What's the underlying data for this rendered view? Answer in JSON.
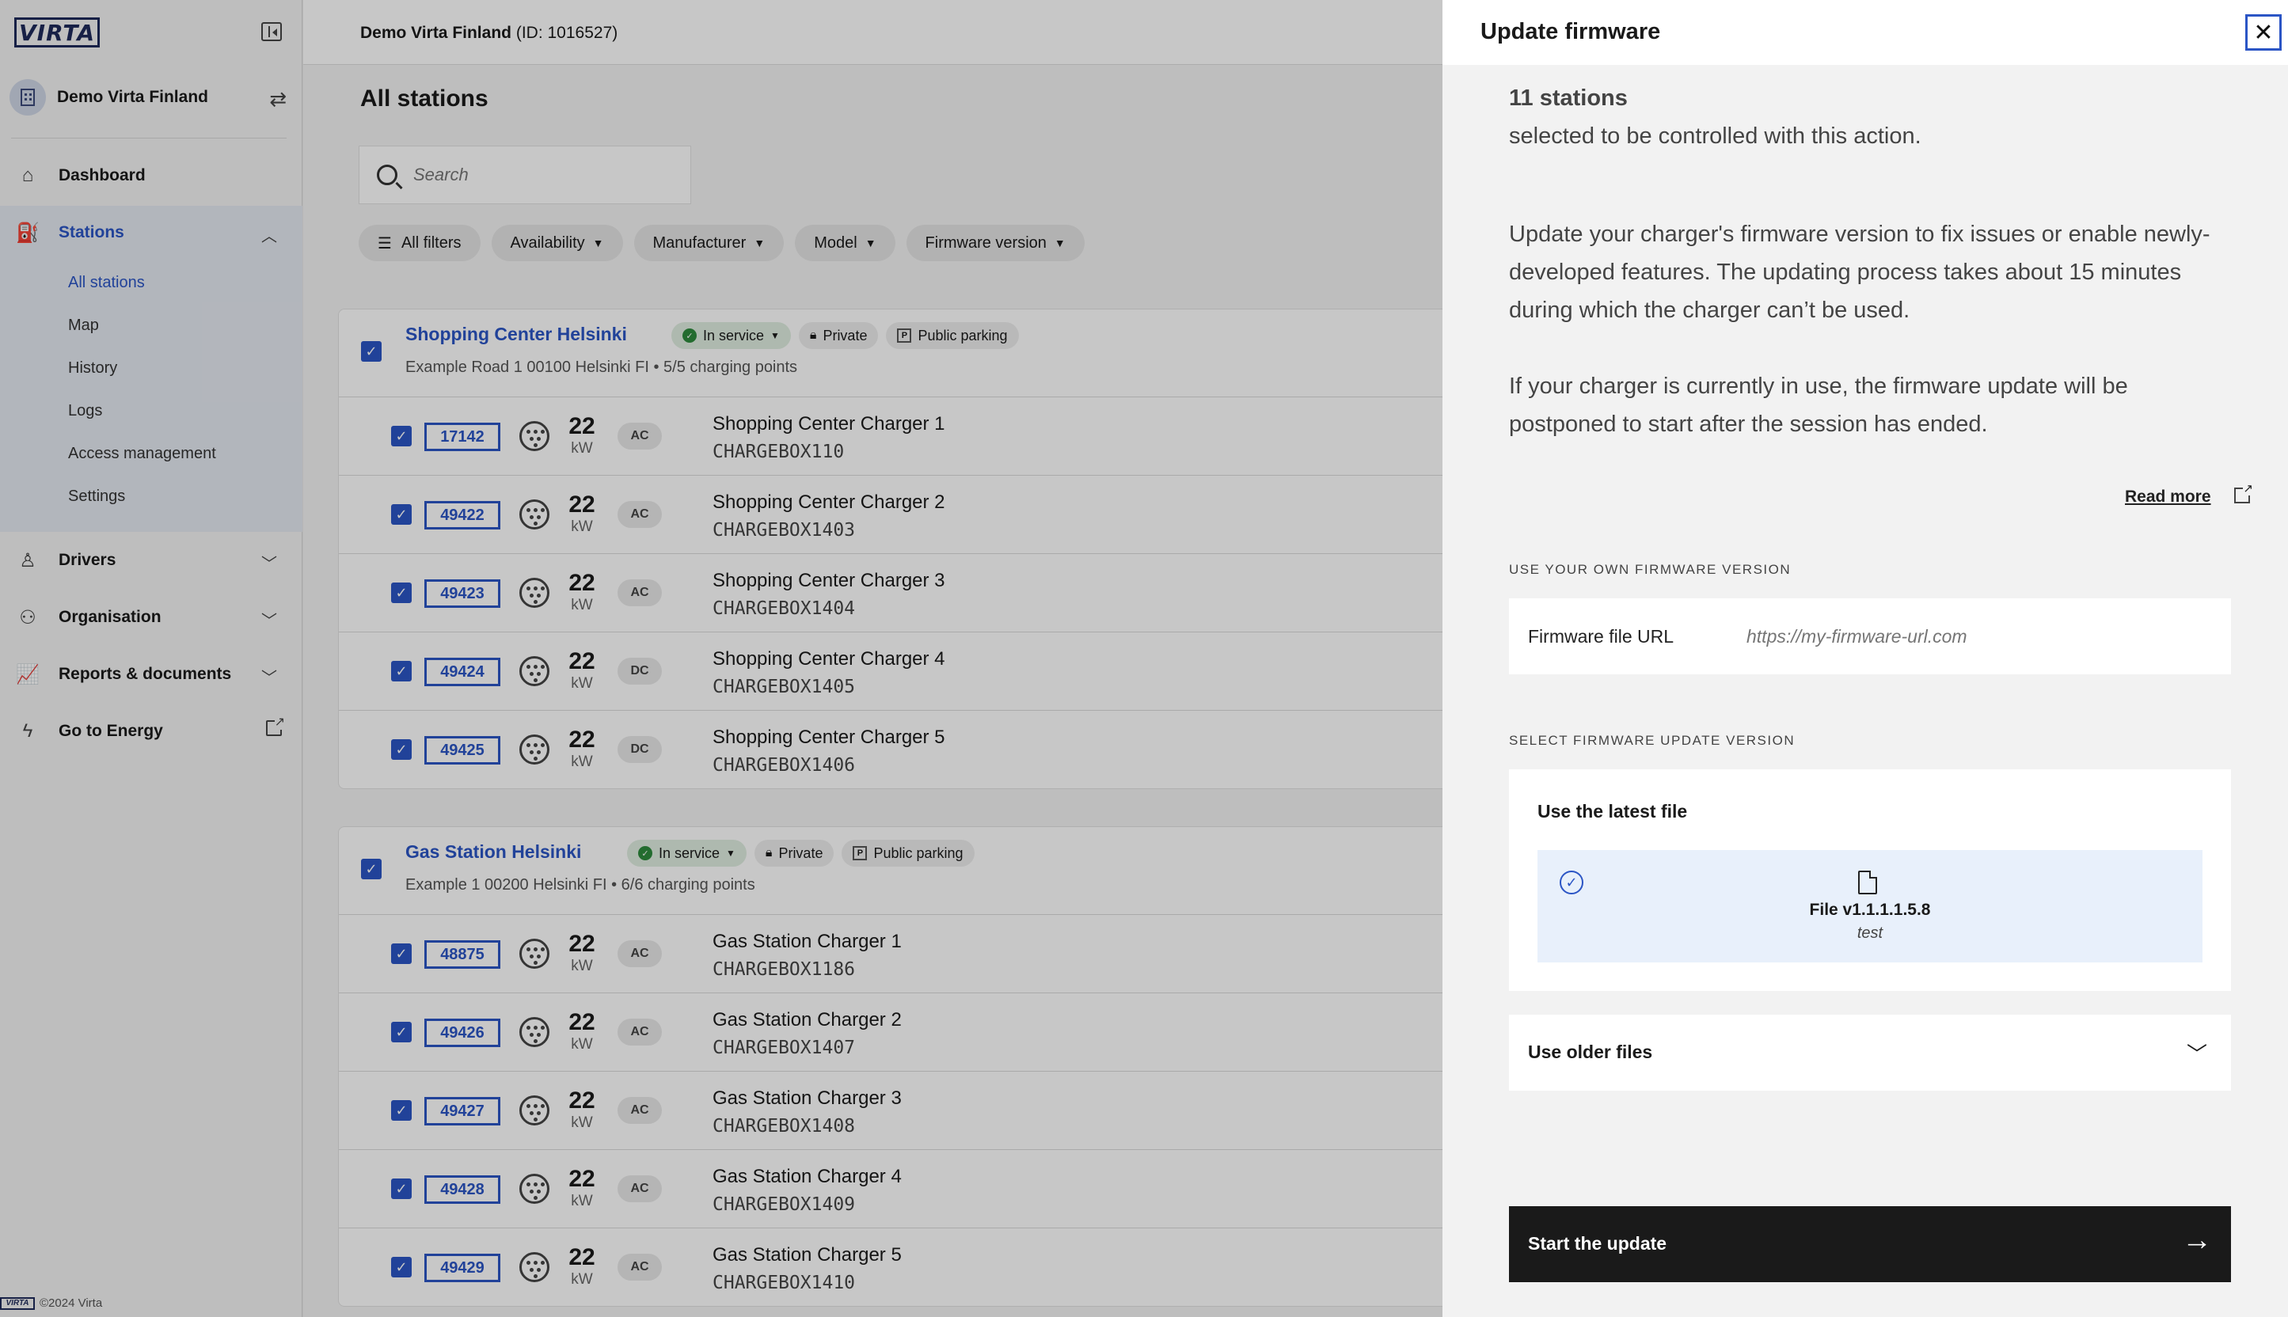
{
  "brand": {
    "logo_text": "VIRTA",
    "copyright": "©2024 Virta"
  },
  "sidebar": {
    "org_name": "Demo Virta Finland",
    "items": [
      {
        "label": "Dashboard",
        "icon": "dashboard-icon"
      },
      {
        "label": "Stations",
        "icon": "stations-icon",
        "expanded": true
      },
      {
        "label": "Drivers",
        "icon": "drivers-icon"
      },
      {
        "label": "Organisation",
        "icon": "organisation-icon"
      },
      {
        "label": "Reports & documents",
        "icon": "reports-icon"
      },
      {
        "label": "Go to Energy",
        "icon": "energy-icon",
        "external": true
      }
    ],
    "station_subitems": [
      "All stations",
      "Map",
      "History",
      "Logs",
      "Access management",
      "Settings"
    ],
    "active_subitem": "All stations"
  },
  "header": {
    "org_name": "Demo Virta Finland",
    "org_id": "(ID: 1016527)"
  },
  "main": {
    "title": "All stations",
    "search_placeholder": "Search",
    "filters": [
      "All filters",
      "Availability",
      "Manufacturer",
      "Model",
      "Firmware version"
    ]
  },
  "stations": [
    {
      "name": "Shopping Center Helsinki",
      "status": "In service",
      "access": "Private",
      "parking": "Public parking",
      "address": "Example Road 1 00100 Helsinki FI • 5/5 charging points",
      "points": [
        {
          "id": "17142",
          "power": "22",
          "unit": "kW",
          "current": "AC",
          "name": "Shopping Center Charger 1",
          "box": "CHARGEBOX110"
        },
        {
          "id": "49422",
          "power": "22",
          "unit": "kW",
          "current": "AC",
          "name": "Shopping Center Charger 2",
          "box": "CHARGEBOX1403"
        },
        {
          "id": "49423",
          "power": "22",
          "unit": "kW",
          "current": "AC",
          "name": "Shopping Center Charger 3",
          "box": "CHARGEBOX1404"
        },
        {
          "id": "49424",
          "power": "22",
          "unit": "kW",
          "current": "DC",
          "name": "Shopping Center Charger 4",
          "box": "CHARGEBOX1405"
        },
        {
          "id": "49425",
          "power": "22",
          "unit": "kW",
          "current": "DC",
          "name": "Shopping Center Charger 5",
          "box": "CHARGEBOX1406"
        }
      ]
    },
    {
      "name": "Gas Station Helsinki",
      "status": "In service",
      "access": "Private",
      "parking": "Public parking",
      "address": "Example 1 00200 Helsinki FI • 6/6 charging points",
      "points": [
        {
          "id": "48875",
          "power": "22",
          "unit": "kW",
          "current": "AC",
          "name": "Gas Station Charger 1",
          "box": "CHARGEBOX1186"
        },
        {
          "id": "49426",
          "power": "22",
          "unit": "kW",
          "current": "AC",
          "name": "Gas Station Charger 2",
          "box": "CHARGEBOX1407"
        },
        {
          "id": "49427",
          "power": "22",
          "unit": "kW",
          "current": "AC",
          "name": "Gas Station Charger 3",
          "box": "CHARGEBOX1408"
        },
        {
          "id": "49428",
          "power": "22",
          "unit": "kW",
          "current": "AC",
          "name": "Gas Station Charger 4",
          "box": "CHARGEBOX1409"
        },
        {
          "id": "49429",
          "power": "22",
          "unit": "kW",
          "current": "AC",
          "name": "Gas Station Charger 5",
          "box": "CHARGEBOX1410"
        }
      ]
    }
  ],
  "drawer": {
    "title": "Update firmware",
    "selected_count": "11 stations",
    "selected_text": "selected to be controlled with this action.",
    "description_1": "Update your charger's firmware version to fix issues or enable newly-developed features. The updating process takes about 15 minutes during which the charger can’t be used.",
    "description_2": "If your charger is currently in use, the firmware update will be postponed to start after the session has ended.",
    "read_more": "Read more",
    "own_section_label": "USE YOUR OWN FIRMWARE VERSION",
    "url_label": "Firmware file URL",
    "url_placeholder": "https://my-firmware-url.com",
    "select_section_label": "SELECT FIRMWARE UPDATE VERSION",
    "latest_title": "Use the latest file",
    "latest_file_name": "File v1.1.1.1.5.8",
    "latest_file_note": "test",
    "older_label": "Use older files",
    "start_label": "Start the update"
  },
  "colors": {
    "accent": "#2b55c5",
    "primary_button": "#1a1a1a",
    "status_ok": "#2e8b3d"
  }
}
